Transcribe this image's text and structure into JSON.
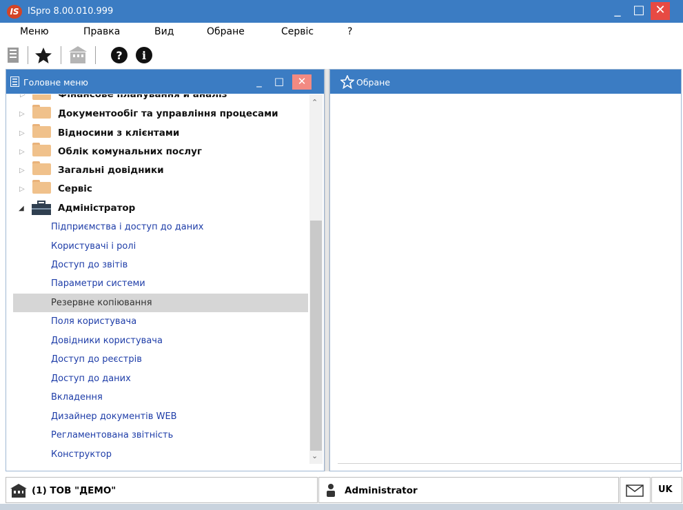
{
  "window": {
    "title": "ISpro 8.00.010.999",
    "logo_text": "IS",
    "minimize_label": "_",
    "maximize_label": "□",
    "close_label": "✕"
  },
  "menu": [
    "Меню",
    "Правка",
    "Вид",
    "Обране",
    "Сервіс",
    "?"
  ],
  "toolbar": {
    "icons": [
      "document-icon",
      "star-icon",
      "building-icon",
      "help-icon",
      "info-icon"
    ]
  },
  "main_menu_panel": {
    "title": "Головне меню",
    "minimize_label": "_",
    "maximize_label": "□",
    "close_label": "✕",
    "groups": [
      "Фінансове планування й аналіз",
      "Документообіг та управління процесами",
      "Відносини з клієнтами",
      "Облік комунальних послуг",
      "Загальні довідники",
      "Сервіс",
      "Адміністратор"
    ],
    "admin_children": [
      "Підприємства і доступ до даних",
      "Користувачі і ролі",
      "Доступ до звітів",
      "Параметри системи",
      "Резервне копіювання",
      "Поля користувача",
      "Довідники користувача",
      "Доступ до реєстрів",
      "Доступ до даних",
      "Вкладення",
      "Дизайнер документів WEB",
      "Регламентована звітність",
      "Конструктор"
    ],
    "selected_item": "Резервне копіювання"
  },
  "favorites_panel": {
    "title": "Обране"
  },
  "status": {
    "company": "(1) ТОВ \"ДЕМО\"",
    "user": "Administrator",
    "language": "UK"
  },
  "colors": {
    "titlebar": "#3b7cc3",
    "close_button": "#e74a43",
    "link_text": "#1e3da8",
    "folder": "#f0c18b",
    "selection": "#d6d6d6"
  }
}
